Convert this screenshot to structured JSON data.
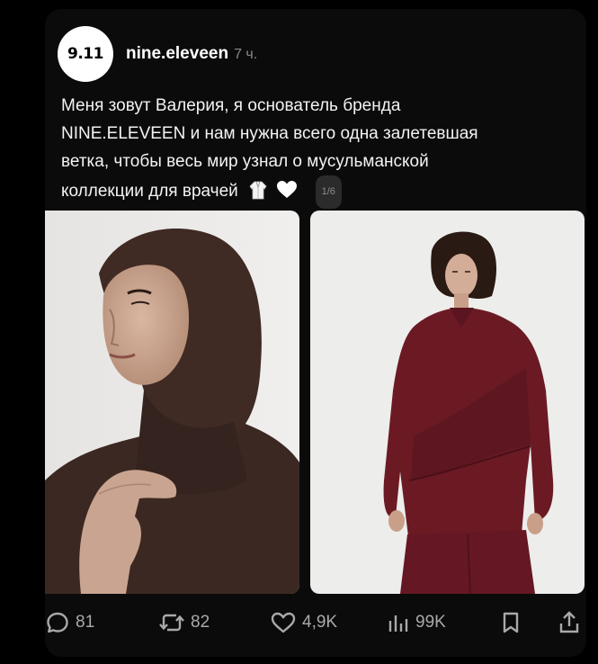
{
  "post": {
    "avatar_text": "9.11",
    "username": "nine.eleveen",
    "time": "7 ч.",
    "text_lines": [
      "Меня зовут Валерия, я основатель бренда",
      "NINE.ELEVEEN и нам нужна всего одна залетевшая",
      "ветка, чтобы весь мир узнал о мусульманской",
      "коллекции для врачей"
    ],
    "media_counter": "1/6"
  },
  "actions": {
    "replies": "81",
    "reposts": "82",
    "likes": "4,9K",
    "views": "99K"
  },
  "colors": {
    "background": "#000000",
    "card": "#0b0b0b",
    "text": "#f3f3f3",
    "muted": "#8a8a8a",
    "brown_garment": "#3a2721",
    "burgundy_garment": "#6b1a22"
  }
}
